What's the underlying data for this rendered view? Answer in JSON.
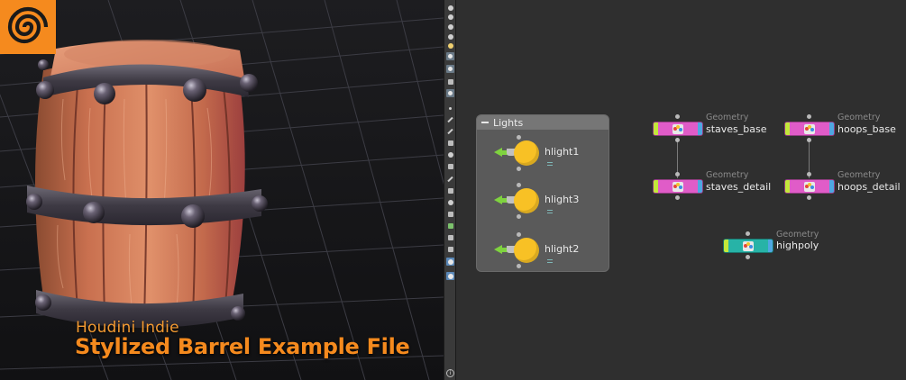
{
  "branding": {
    "product": "Houdini Indie",
    "title": "Stylized Barrel Example File"
  },
  "network": {
    "network_box": {
      "label": "Lights"
    },
    "lights": [
      {
        "name": "hlight1"
      },
      {
        "name": "hlight3"
      },
      {
        "name": "hlight2"
      }
    ],
    "geometry_nodes": [
      {
        "type": "Geometry",
        "name": "staves_base",
        "color": "#e05cc8"
      },
      {
        "type": "Geometry",
        "name": "hoops_base",
        "color": "#e05cc8"
      },
      {
        "type": "Geometry",
        "name": "staves_detail",
        "color": "#e05cc8"
      },
      {
        "type": "Geometry",
        "name": "hoops_detail",
        "color": "#e05cc8"
      },
      {
        "type": "Geometry",
        "name": "highpoly",
        "color": "#27b3a7"
      }
    ]
  },
  "colors": {
    "accent_orange": "#f58a1e",
    "light_yellow": "#f8c125",
    "light_green": "#7fd33f",
    "network_bg": "#2f2f2f"
  },
  "icons": {
    "brand": "houdini-swirl-logo",
    "toolbar": [
      "select-icon",
      "pose-icon",
      "handle-icon",
      "light-icon",
      "light-icon",
      "camera-icon",
      "view-icon",
      "snap-icon",
      "grid-icon",
      "point-icon",
      "edge-icon",
      "brush-icon",
      "group-icon",
      "visibility-icon",
      "render-icon",
      "info-icon"
    ]
  }
}
